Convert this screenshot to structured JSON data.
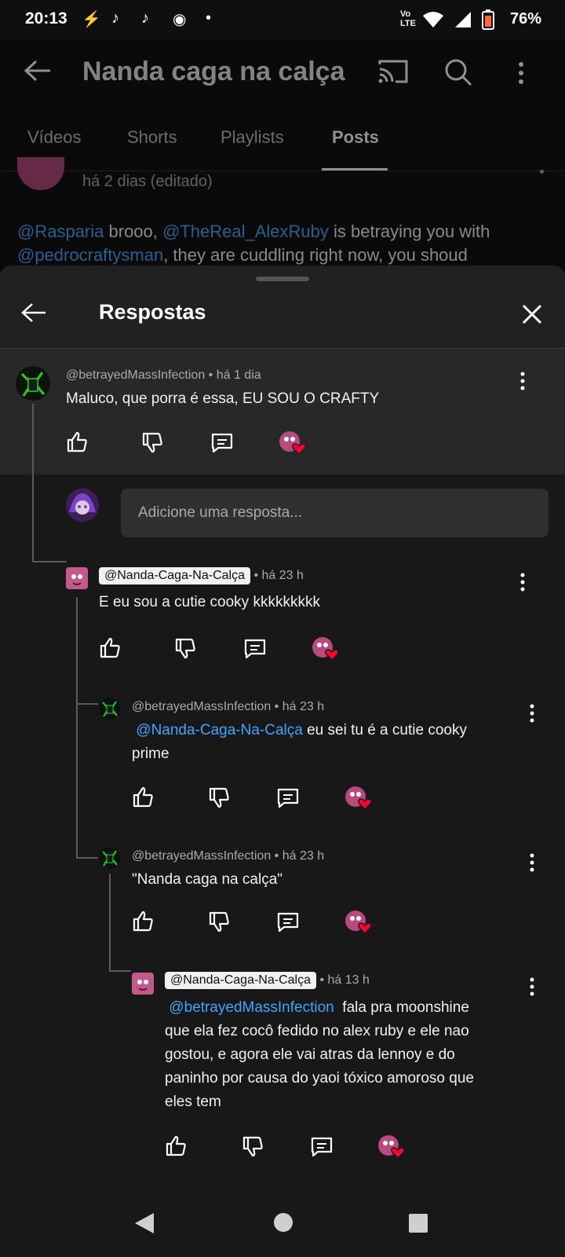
{
  "status_bar": {
    "time": "20:13",
    "battery": "76%"
  },
  "header": {
    "title": "Nanda caga na calça"
  },
  "tabs": [
    {
      "label": "Vídeos"
    },
    {
      "label": "Shorts"
    },
    {
      "label": "Playlists"
    },
    {
      "label": "Posts",
      "active": true
    }
  ],
  "post": {
    "time": "há 2 dias (editado)",
    "mention1": "@Rasparia",
    "text1": " brooo, ",
    "mention2": "@TheReal_AlexRuby",
    "text2": " is betraying you with",
    "mention3": "@pedrocraftysman",
    "text3": ", they are cuddling right now, you shoud"
  },
  "sheet": {
    "title": "Respostas"
  },
  "parent_comment": {
    "author": "@betrayedMassInfection",
    "time": "• há 1 dia",
    "text": "Maluco, que porra é essa, EU SOU O CRAFTY"
  },
  "reply_input": {
    "placeholder": "Adicione uma resposta..."
  },
  "replies": [
    {
      "author": "@Nanda-Caga-Na-Calça",
      "time": "• há 23 h",
      "text": "E eu sou a cutie cooky kkkkkkkkk"
    },
    {
      "author": "@betrayedMassInfection",
      "time": "• há 23 h",
      "mention": "@Nanda-Caga-Na-Calça",
      "text": " eu sei tu é a cutie cooky",
      "text2": "prime"
    },
    {
      "author": "@betrayedMassInfection",
      "time": "• há 23 h",
      "text": "\"Nanda caga na calça\""
    },
    {
      "author": "@Nanda-Caga-Na-Calça",
      "time": "• há 13 h",
      "mention": "@betrayedMassInfection",
      "line1": "  fala pra moonshine",
      "line2": "que ela fez cocô fedido no alex ruby e ele nao",
      "line3": "gostou, e agora ele vai atras da lennoy e do",
      "line4": "paninho por causa do yaoi tóxico amoroso que",
      "line5": "eles tem"
    }
  ],
  "colors": {
    "link": "#3ea6ff",
    "heart": "#ff0033",
    "background": "#0f0f0f",
    "sheet": "#212121"
  }
}
